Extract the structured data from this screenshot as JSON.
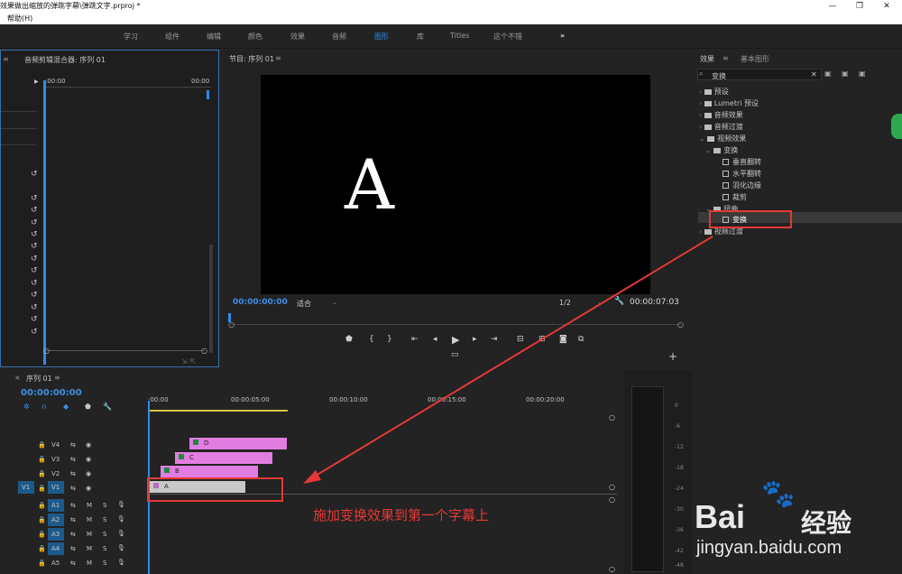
{
  "window": {
    "title": "效果做出缩放的弹跳字幕\\弹跳文字.prproj *",
    "menu": "帮助(H)",
    "controls": [
      "—",
      "❐",
      "✕"
    ]
  },
  "workspaces": [
    "学习",
    "组件",
    "编辑",
    "颜色",
    "效果",
    "音频",
    "图形",
    "库",
    "Titles",
    "这个不错",
    "»"
  ],
  "workspace_active": "图形",
  "left_panel": {
    "title": "音频剪辑混合器: 序列 01",
    "time_start": ":00:00",
    "time_end": "00:00"
  },
  "program": {
    "title": "节目: 序列 01",
    "timecode": "00:00:00:00",
    "fit": "适合",
    "resolution": "1/2",
    "duration": "00:00:07:03",
    "video_text": "A"
  },
  "effects": {
    "tabs": [
      "效果",
      "基本图形"
    ],
    "search": "变换",
    "tree": [
      {
        "label": "预设",
        "level": 0,
        "kind": "folder"
      },
      {
        "label": "Lumetri 预设",
        "level": 0,
        "kind": "folder"
      },
      {
        "label": "音频效果",
        "level": 0,
        "kind": "folder"
      },
      {
        "label": "音频过渡",
        "level": 0,
        "kind": "folder"
      },
      {
        "label": "视频效果",
        "level": 0,
        "kind": "folder-open"
      },
      {
        "label": "变换",
        "level": 1,
        "kind": "folder-open"
      },
      {
        "label": "垂直翻转",
        "level": 2,
        "kind": "fx"
      },
      {
        "label": "水平翻转",
        "level": 2,
        "kind": "fx"
      },
      {
        "label": "羽化边缘",
        "level": 2,
        "kind": "fx"
      },
      {
        "label": "裁剪",
        "level": 2,
        "kind": "fx"
      },
      {
        "label": "扭曲",
        "level": 1,
        "kind": "folder-open"
      },
      {
        "label": "变换",
        "level": 2,
        "kind": "fx-selected"
      },
      {
        "label": "视频过渡",
        "level": 0,
        "kind": "folder"
      }
    ]
  },
  "timeline": {
    "title": "序列 01",
    "timecode": "00:00:00:00",
    "ruler": [
      ":00:00",
      "00:00:05:00",
      "00:00:10:00",
      "00:00:15:00",
      "00:00:20:00"
    ],
    "video_tracks": [
      "V4",
      "V3",
      "V2",
      "V1"
    ],
    "audio_tracks": [
      "A1",
      "A2",
      "A3",
      "A4",
      "A5"
    ],
    "src_v": "V1",
    "clips": [
      {
        "label": "D",
        "track": "V4"
      },
      {
        "label": "C",
        "track": "V3"
      },
      {
        "label": "B",
        "track": "V2"
      },
      {
        "label": "A",
        "track": "V1"
      }
    ],
    "track_m": "M",
    "track_s": "S"
  },
  "meter": {
    "scale": [
      "0",
      "-6",
      "-12",
      "-18",
      "-24",
      "-30",
      "-36",
      "-42",
      "-48",
      "-54"
    ]
  },
  "annotation": "施加变换效果到第一个字幕上",
  "watermark": {
    "brand": "Bai",
    "brand2": "经验",
    "url": "jingyan.baidu.com"
  },
  "colors": {
    "accent": "#2d8ceb",
    "clip_pink": "#e17de0",
    "clip_gray": "#c8c8c8",
    "annotation_red": "#e53935"
  }
}
